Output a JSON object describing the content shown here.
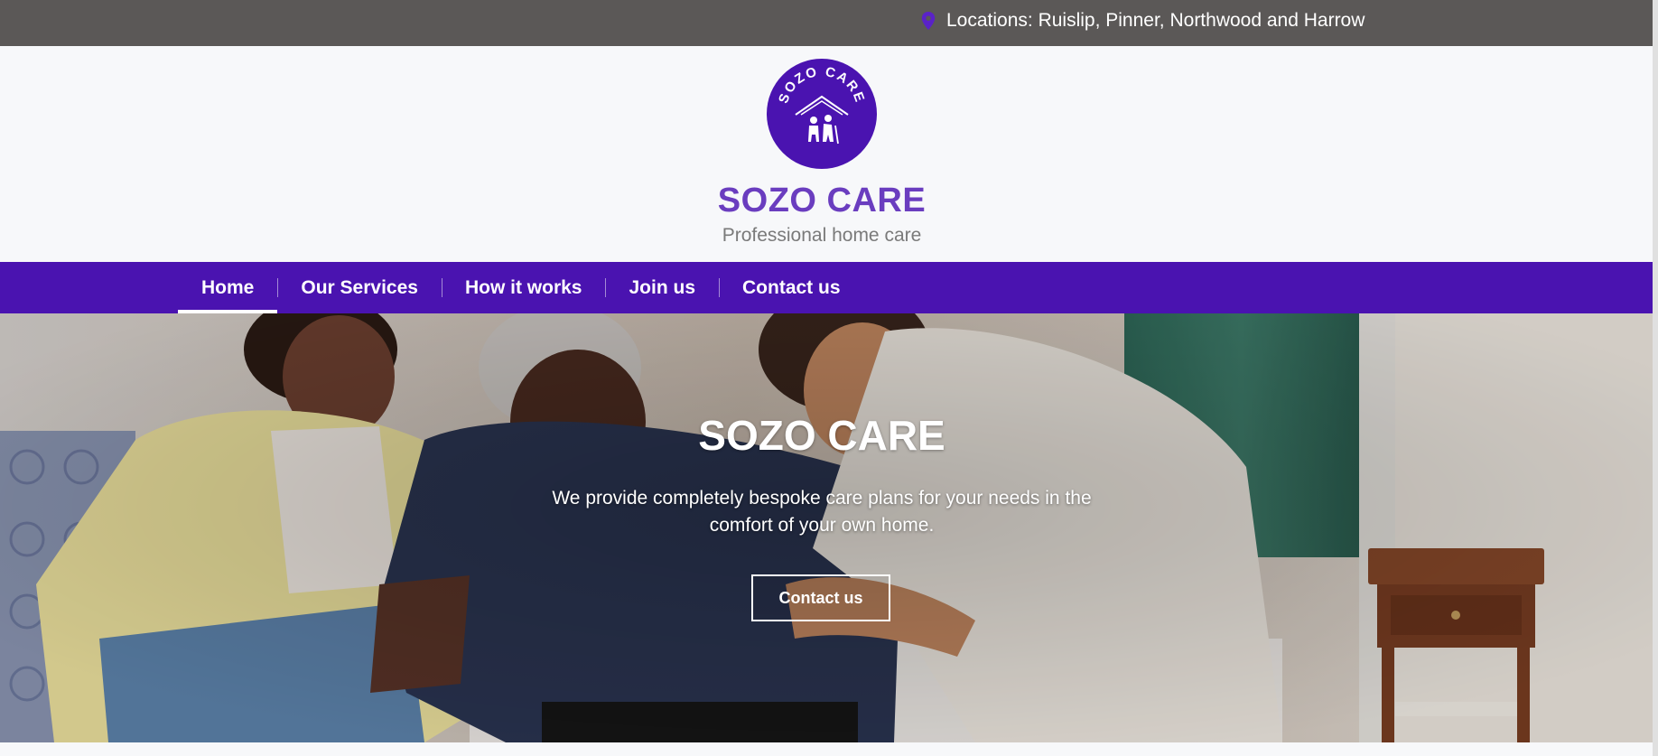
{
  "topbar": {
    "location_icon": "map-pin-icon",
    "location_text": "Locations: Ruislip, Pinner, Northwood and Harrow"
  },
  "header": {
    "logo_icon": "sozo-care-logo",
    "logo_text": "SOZO CARE",
    "title": "SOZO CARE",
    "tagline": "Professional home care"
  },
  "nav": {
    "items": [
      {
        "label": "Home",
        "active": true
      },
      {
        "label": "Our Services"
      },
      {
        "label": "How it works"
      },
      {
        "label": "Join us"
      },
      {
        "label": "Contact us"
      }
    ]
  },
  "hero": {
    "title": "SOZO CARE",
    "text": "We provide completely bespoke care plans for your needs in the comfort of your own home.",
    "button_label": "Contact us"
  },
  "colors": {
    "topbar": "#5b5857",
    "brand_purple": "#4a13b0",
    "title_purple": "#6a3dbf",
    "tagline_gray": "#7a7a7a"
  }
}
